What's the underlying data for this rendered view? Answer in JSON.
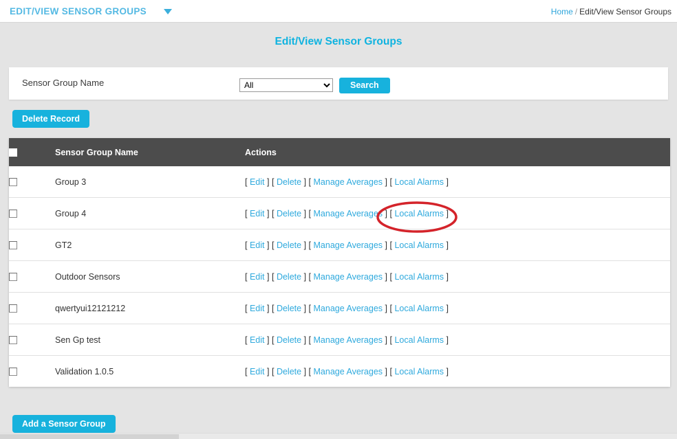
{
  "topbar": {
    "title": "EDIT/VIEW SENSOR GROUPS",
    "caret_icon": "chevron-down-icon",
    "breadcrumb": {
      "home": "Home",
      "separator": "/",
      "current": "Edit/View Sensor Groups"
    }
  },
  "page": {
    "title": "Edit/View Sensor Groups"
  },
  "search": {
    "label": "Sensor Group Name",
    "selected_value": "All",
    "options": [
      "All"
    ],
    "button_label": "Search"
  },
  "toolbar": {
    "delete_record_label": "Delete Record",
    "add_group_label": "Add a Sensor Group"
  },
  "table": {
    "columns": [
      "",
      "Sensor Group Name",
      "Actions"
    ],
    "header_select_all": "select-all-checkbox",
    "action_labels": {
      "edit": "Edit",
      "delete": "Delete",
      "manage_averages": "Manage Averages",
      "local_alarms": "Local Alarms",
      "bracket_open": "[",
      "bracket_close": "]"
    },
    "rows": [
      {
        "name": "Group 3"
      },
      {
        "name": "Group 4"
      },
      {
        "name": "GT2"
      },
      {
        "name": "Outdoor Sensors"
      },
      {
        "name": "qwertyui12121212"
      },
      {
        "name": "Sen Gp test"
      },
      {
        "name": "Validation 1.0.5"
      }
    ]
  },
  "annotation": {
    "type": "ellipse-highlight",
    "target": "Local Alarms link in Group 4 row",
    "color": "#d4232a"
  },
  "colors": {
    "accent": "#17b2dd",
    "title": "#0fb3e0",
    "link": "#2ea9dd",
    "header_bar": "#4c4c4c",
    "page_bg": "#e4e4e4",
    "annotation_red": "#d4232a"
  }
}
